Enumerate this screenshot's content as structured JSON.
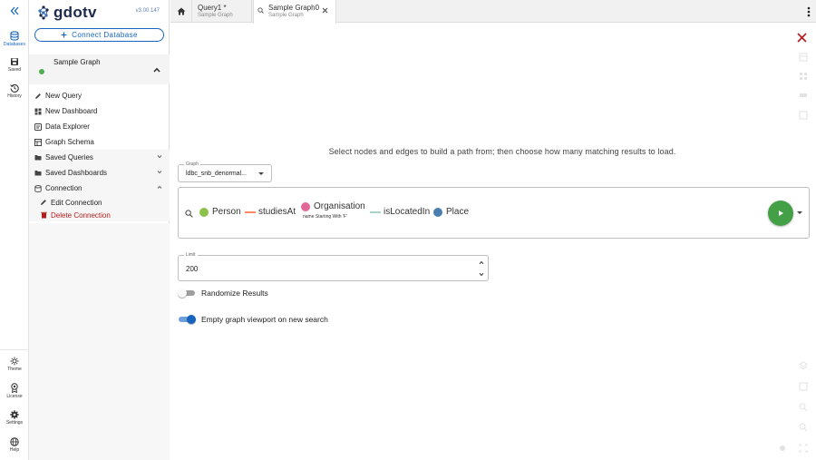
{
  "rail": {
    "databases": "Databases",
    "saved": "Saved",
    "history": "History",
    "theme": "Theme",
    "license": "License",
    "settings": "Settings",
    "help": "Help"
  },
  "sidebar": {
    "logo": "gdotv",
    "version": "v3.00.147",
    "connect_label": "Connect Database",
    "graph_name": "Sample Graph",
    "status_color": "#4caf50",
    "menu": {
      "new_query": "New Query",
      "new_dashboard": "New Dashboard",
      "data_explorer": "Data Explorer",
      "graph_schema": "Graph Schema",
      "saved_queries": "Saved Queries",
      "saved_dashboards": "Saved Dashboards",
      "connection": "Connection",
      "edit_connection": "Edit Connection",
      "delete_connection": "Delete Connection"
    }
  },
  "tabs": [
    {
      "title": "Query1 *",
      "subtitle": "Sample Graph"
    },
    {
      "title": "Sample Graph0",
      "subtitle": "Sample Graph"
    }
  ],
  "main": {
    "instruction": "Select nodes and edges to build a path from; then choose how many matching results to load.",
    "graph_select": {
      "label": "Graph",
      "value": "ldbc_snb_denormal..."
    },
    "path": [
      {
        "kind": "node",
        "label": "Person",
        "color": "#8bc34a"
      },
      {
        "kind": "edge",
        "label": "studiesAt",
        "color": "#ff8a65"
      },
      {
        "kind": "node",
        "label": "Organisation",
        "color": "#e06796",
        "filter": "name Starting With 'F'"
      },
      {
        "kind": "edge",
        "label": "isLocatedIn",
        "color": "#a5d6c8"
      },
      {
        "kind": "node",
        "label": "Place",
        "color": "#4a7fb0"
      }
    ],
    "limit": {
      "label": "Limit",
      "value": "200"
    },
    "randomize": {
      "label": "Randomize Results",
      "on": false
    },
    "empty_viewport": {
      "label": "Empty graph viewport on new search",
      "on": true
    },
    "accent_color": "#1565c0",
    "run_color": "#43a047"
  }
}
